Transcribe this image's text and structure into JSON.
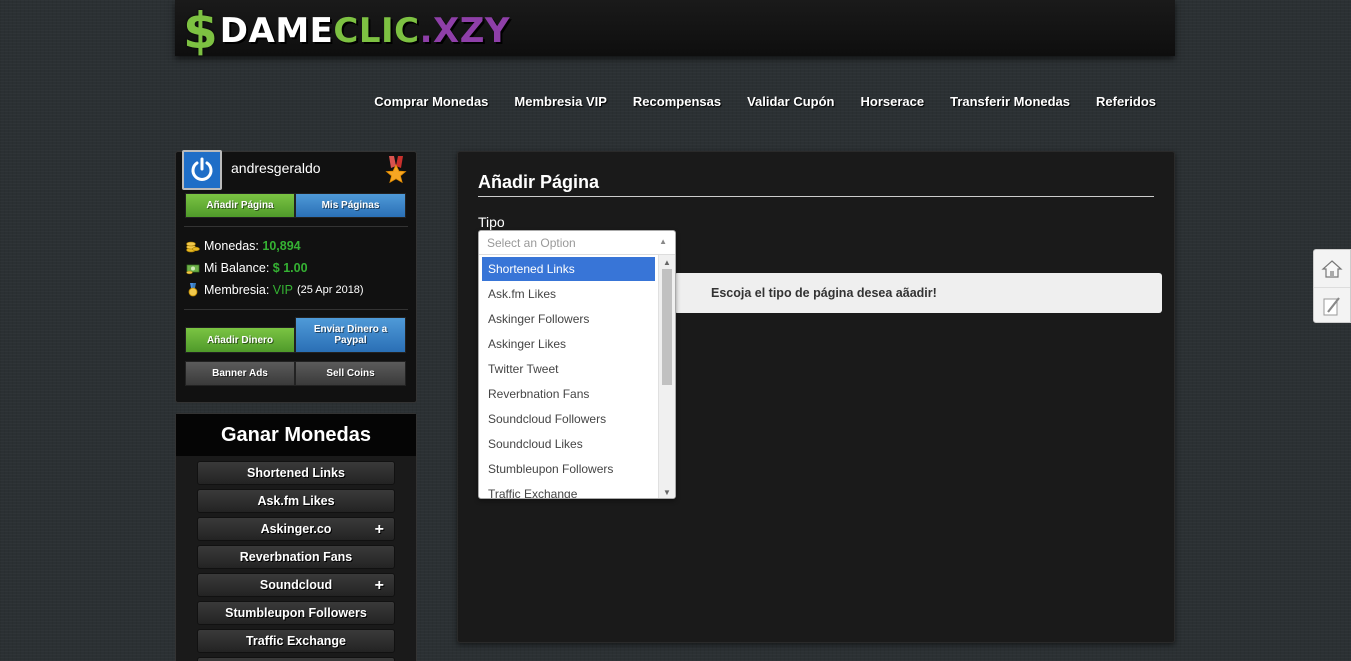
{
  "logo": {
    "dollar": "$",
    "dame": "DAME",
    "clic": "CLIC",
    "xzy": ".XZY"
  },
  "nav": [
    "Comprar Monedas",
    "Membresia VIP",
    "Recompensas",
    "Validar Cupón",
    "Horserace",
    "Transferir Monedas",
    "Referidos"
  ],
  "profile": {
    "username": "andresgeraldo",
    "add_page": "Añadir Página",
    "my_pages": "Mis Páginas",
    "coins_label": "Monedas:",
    "coins_value": "10,894",
    "balance_label": "Mi Balance:",
    "balance_value": "$ 1.00",
    "membership_label": "Membresia:",
    "membership_value": "VIP",
    "membership_date": "(25 Apr 2018)",
    "add_money": "Añadir Dinero",
    "send_money": "Enviar Dinero a Paypal",
    "banner_ads": "Banner Ads",
    "sell_coins": "Sell Coins"
  },
  "ganar": {
    "title": "Ganar Monedas",
    "items": [
      "Shortened Links",
      "Ask.fm Likes",
      "Askinger.co",
      "Reverbnation Fans",
      "Soundcloud",
      "Stumbleupon Followers",
      "Traffic Exchange"
    ]
  },
  "main": {
    "title": "Añadir Página",
    "tipo_label": "Tipo",
    "notice": "Escoja el tipo de página desea aãadir!"
  },
  "select": {
    "placeholder": "Select an Option",
    "options": [
      "Shortened Links",
      "Ask.fm Likes",
      "Askinger Followers",
      "Askinger Likes",
      "Twitter Tweet",
      "Reverbnation Fans",
      "Soundcloud Followers",
      "Soundcloud Likes",
      "Stumbleupon Followers",
      "Traffic Exchange"
    ]
  },
  "colors": {
    "green": "#7dc142",
    "purple": "#8e3fa8",
    "blue": "#3875d7"
  }
}
